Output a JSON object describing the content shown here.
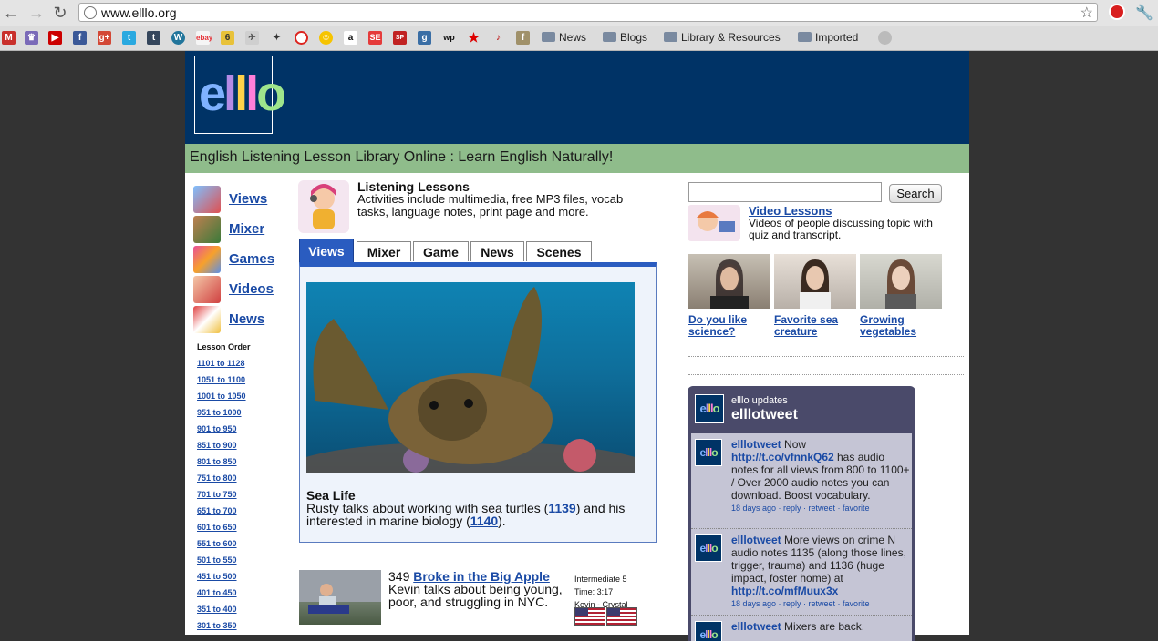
{
  "browser": {
    "url": "www.elllo.org",
    "back_glyph": "←",
    "forward_glyph": "→",
    "reload_glyph": "↻",
    "star_glyph": "☆",
    "wrench_glyph": "🔧",
    "bookmark_folders": [
      "News",
      "Blogs",
      "Library & Resources",
      "Imported"
    ]
  },
  "site": {
    "logo_text": "elllo",
    "tagline": "English Listening Lesson Library Online : Learn English Naturally!",
    "header_color": "#003366",
    "tagline_bg": "#8fbc8b"
  },
  "sidebar": {
    "nav": [
      "Views",
      "Mixer",
      "Games",
      "Videos",
      "News"
    ],
    "lesson_order_label": "Lesson Order",
    "ranges": [
      "1101 to 1128",
      "1051 to 1100",
      "1001 to 1050",
      "951 to 1000",
      "901 to 950",
      "851 to 900",
      "801 to 850",
      "751 to 800",
      "701 to 750",
      "651 to 700",
      "601 to 650",
      "551 to 600",
      "501 to 550",
      "451 to 500",
      "401 to 450",
      "351 to 400",
      "301 to 350"
    ]
  },
  "main": {
    "listening_title": "Listening Lessons",
    "listening_desc": "Activities include multimedia, free MP3 files, vocab tasks, language notes, print page and more.",
    "tabs": [
      "Views",
      "Mixer",
      "Game",
      "News",
      "Scenes"
    ],
    "feature": {
      "title": "Sea Life",
      "desc_part1": "Rusty talks about working with sea turtles (",
      "link1": "1139",
      "desc_part2": ") and his interested in marine biology (",
      "link2": "1140",
      "desc_part3": ")."
    },
    "lesson": {
      "number": "349",
      "link": "Broke in the Big Apple",
      "desc": "Kevin talks about being young, poor, and struggling in NYC.",
      "level": "Intermediate 5",
      "time": "Time: 3:17",
      "speakers": "Kevin - Crystal"
    }
  },
  "right": {
    "search_button": "Search",
    "search_value": "",
    "video_lessons_title": "Video Lessons",
    "video_lessons_desc": "Videos of people discussing topic with quiz and transcript.",
    "videos": [
      "Do you like science?",
      "Favorite sea creature",
      "Growing vegetables"
    ],
    "twitter": {
      "small_label": "elllo updates",
      "handle": "elllotweet",
      "logo_text": "elllo",
      "tweets": [
        {
          "user": "elllotweet",
          "text1": "Now ",
          "link": "http://t.co/vfnnkQ62",
          "text2": " has audio notes for all views from 800 to 1100+ / Over 2000 audio notes you can download. Boost vocabulary.",
          "meta": "18 days ago · reply · retweet · favorite"
        },
        {
          "user": "elllotweet",
          "text1": "More views on crime N audio notes 1135 (along those lines, trigger, trauma) and 1136 (huge impact, foster home) at ",
          "link": "http://t.co/mfMuux3x",
          "text2": "",
          "meta": "18 days ago · reply · retweet · favorite"
        },
        {
          "user": "elllotweet",
          "text1": "Mixers are back.",
          "link": "",
          "text2": "",
          "meta": ""
        }
      ]
    }
  }
}
